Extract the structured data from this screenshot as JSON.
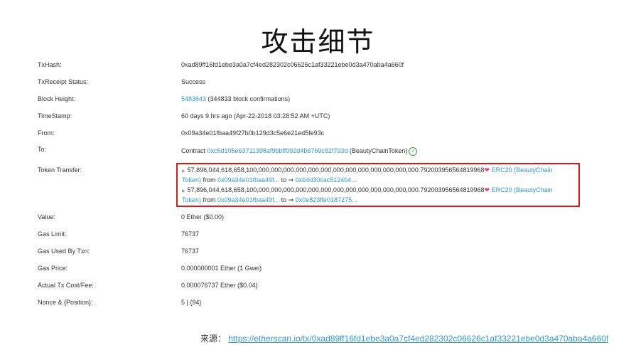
{
  "title": "攻击细节",
  "rows": {
    "txhash": {
      "label": "TxHash:",
      "value": "0xad89ff16fd1ebe3a0a7cf4ed282302c06626c1af33221ebe0d3a470aba4a660f"
    },
    "status": {
      "label": "TxReceipt Status:",
      "value": "Success"
    },
    "block": {
      "label": "Block Height:",
      "link": "5483643",
      "suffix": " (344833 block confirmations)"
    },
    "timestamp": {
      "label": "TimeStamp:",
      "value": "60 days 9 hrs ago (Apr-22-2018 03:28:52 AM +UTC)"
    },
    "from": {
      "label": "From:",
      "value": "0x09a34e01fbaa49f27b0b129d3c5e6e21ed5fe93c"
    },
    "to": {
      "label": "To:",
      "prefix": "Contract ",
      "link": "0xc5d105e63711398af9bbff092d4b6769c82f793d",
      "suffix": " (BeautyChainToken)",
      "icon": "check-circle-icon"
    },
    "token_transfer": {
      "label": "Token Transfer:"
    },
    "value": {
      "label": "Value:",
      "value": "0 Ether ($0.00)"
    },
    "gas_limit": {
      "label": "Gas Limit:",
      "value": "76737"
    },
    "gas_used": {
      "label": "Gas Used By Txn:",
      "value": "76737"
    },
    "gas_price": {
      "label": "Gas Price:",
      "value": "0.000000001 Ether (1 Gwei)"
    },
    "actual_fee": {
      "label": "Actual Tx Cost/Fee:",
      "value": "0.000076737 Ether ($0.04)"
    },
    "nonce": {
      "label": "Nonce & {Position}:",
      "value": "5 | {94}"
    }
  },
  "transfers": [
    {
      "amount": "57,896,044,618,658,100,000,000,000,000,000,000,000,000,000,000,000,000,000.792003956564819968",
      "token_a": "ERC20 (BeautyChain",
      "token_b": "Token)",
      "from_label": " from ",
      "from": "0x09a34e01fbaa49f...",
      "to_label": " to ➞ ",
      "to": "0xb4d30cac5124b4..."
    },
    {
      "amount": "57,896,044,618,658,100,000,000,000,000,000,000,000,000,000,000,000,000,000.792003956564819968",
      "token_a": "ERC20 (BeautyChain",
      "token_b": "Token)",
      "from_label": " from ",
      "from": "0x09a34e01fbaa49f...",
      "to_label": " to ➞ ",
      "to": "0x0e823ffe0187275..."
    }
  ],
  "footer": {
    "label": "来源：",
    "url": "https://etherscan.io/tx/0xad89ff16fd1ebe3a0a7cf4ed282302c06626c1af33221ebe0d3a470aba4a660f"
  },
  "colors": {
    "link": "#3498db",
    "success": "#2e9b3a",
    "highlight_border": "#d91a1a"
  }
}
